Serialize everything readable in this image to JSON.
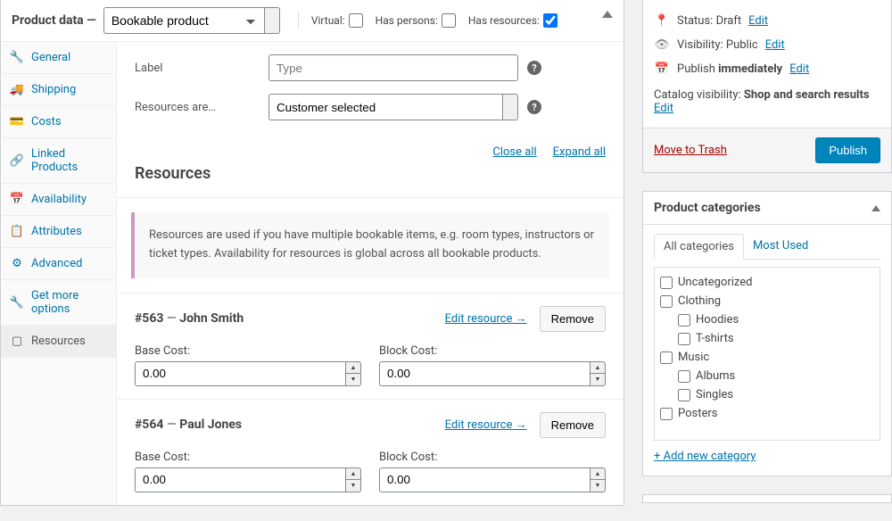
{
  "product_data": {
    "title": "Product data",
    "type_selected": "Bookable product",
    "options": {
      "virtual_label": "Virtual:",
      "virtual_checked": false,
      "has_persons_label": "Has persons:",
      "has_persons_checked": false,
      "has_resources_label": "Has resources:",
      "has_resources_checked": true
    }
  },
  "tabs": [
    {
      "label": "General",
      "icon": "wrench"
    },
    {
      "label": "Shipping",
      "icon": "truck"
    },
    {
      "label": "Costs",
      "icon": "money"
    },
    {
      "label": "Linked Products",
      "icon": "link"
    },
    {
      "label": "Availability",
      "icon": "calendar"
    },
    {
      "label": "Attributes",
      "icon": "list"
    },
    {
      "label": "Advanced",
      "icon": "gear"
    },
    {
      "label": "Get more options",
      "icon": "wrench"
    },
    {
      "label": "Resources",
      "icon": "box"
    }
  ],
  "panel": {
    "label_field": "Label",
    "label_placeholder": "Type",
    "resources_are_label": "Resources are…",
    "resources_are_value": "Customer selected",
    "close_all": "Close all",
    "expand_all": "Expand all",
    "heading": "Resources",
    "info": "Resources are used if you have multiple bookable items, e.g. room types, instructors or ticket types. Availability for resources is global across all bookable products.",
    "edit_resource": "Edit resource →",
    "remove": "Remove",
    "base_cost": "Base Cost:",
    "block_cost": "Block Cost:",
    "resources": [
      {
        "id": "#563",
        "name": "John Smith",
        "base": "0.00",
        "block": "0.00"
      },
      {
        "id": "#564",
        "name": "Paul Jones",
        "base": "0.00",
        "block": "0.00"
      }
    ]
  },
  "publish": {
    "status_label": "Status:",
    "status_value": "Draft",
    "visibility_label": "Visibility:",
    "visibility_value": "Public",
    "publish_label": "Publish",
    "publish_value": "immediately",
    "edit": "Edit",
    "catalog_label": "Catalog visibility:",
    "catalog_value": "Shop and search results",
    "trash": "Move to Trash",
    "publish_btn": "Publish"
  },
  "categories": {
    "title": "Product categories",
    "tab_all": "All categories",
    "tab_most": "Most Used",
    "items": [
      {
        "label": "Uncategorized",
        "child": false
      },
      {
        "label": "Clothing",
        "child": false
      },
      {
        "label": "Hoodies",
        "child": true
      },
      {
        "label": "T-shirts",
        "child": true
      },
      {
        "label": "Music",
        "child": false
      },
      {
        "label": "Albums",
        "child": true
      },
      {
        "label": "Singles",
        "child": true
      },
      {
        "label": "Posters",
        "child": false
      }
    ],
    "add_new": "+ Add new category"
  }
}
